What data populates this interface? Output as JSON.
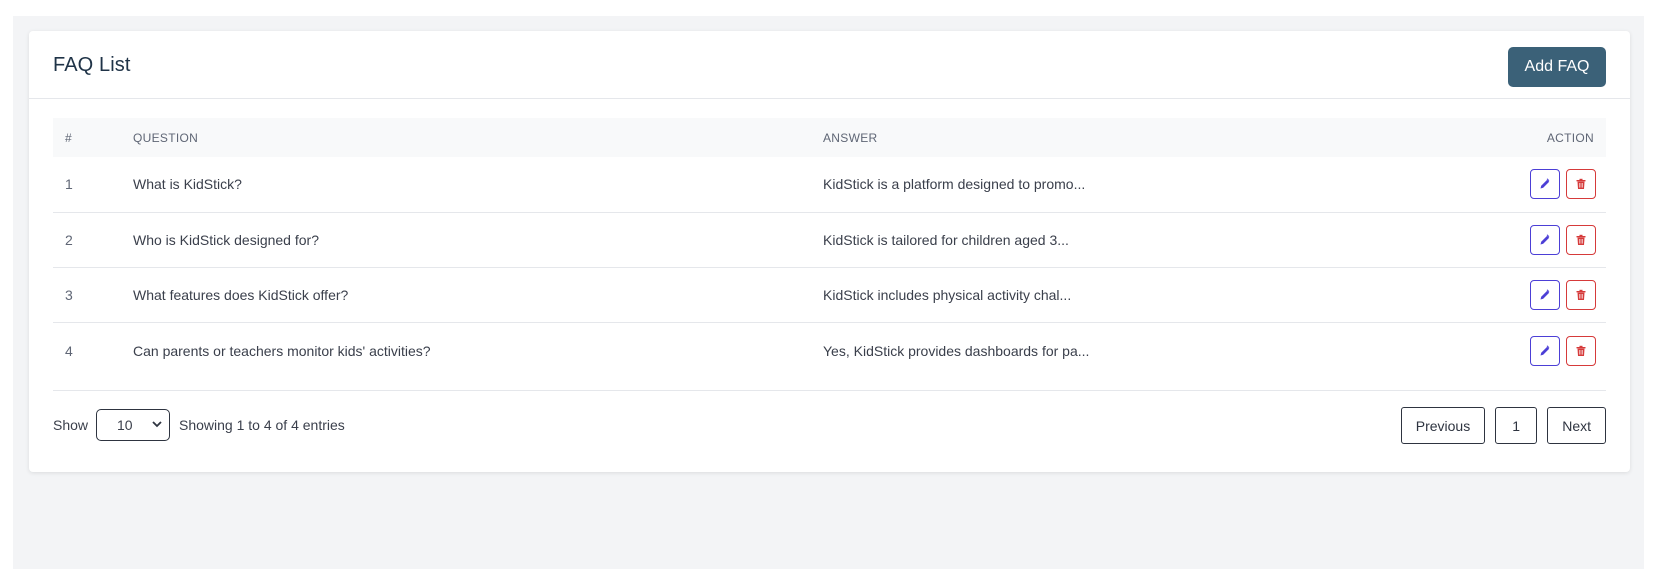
{
  "card": {
    "title": "FAQ List",
    "add_button_label": "Add FAQ"
  },
  "table": {
    "columns": [
      "#",
      "QUESTION",
      "ANSWER",
      "ACTION"
    ],
    "rows": [
      {
        "num": "1",
        "question": "What is KidStick?",
        "answer": "KidStick is a platform designed to promo..."
      },
      {
        "num": "2",
        "question": "Who is KidStick designed for?",
        "answer": "KidStick is tailored for children aged 3..."
      },
      {
        "num": "3",
        "question": "What features does KidStick offer?",
        "answer": "KidStick includes physical activity chal..."
      },
      {
        "num": "4",
        "question": "Can parents or teachers monitor kids' activities?",
        "answer": "Yes, KidStick provides dashboards for pa..."
      }
    ],
    "actions": {
      "edit_icon": "pencil-icon",
      "delete_icon": "trash-icon"
    }
  },
  "footer": {
    "show_label": "Show",
    "page_size": "10",
    "entries_info": "Showing 1 to 4 of 4 entries",
    "previous_label": "Previous",
    "current_page": "1",
    "next_label": "Next"
  },
  "colors": {
    "primary_button": "#3b6178",
    "edit_accent": "#4c3fd6",
    "delete_accent": "#d63a3a",
    "page_background": "#f3f4f6"
  }
}
